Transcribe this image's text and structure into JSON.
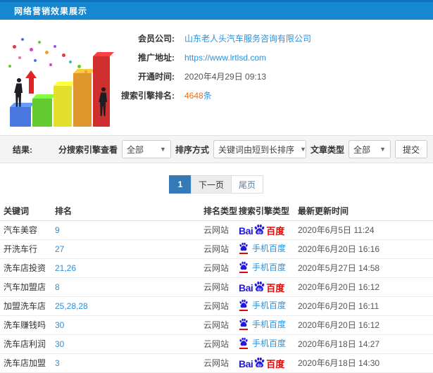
{
  "header": {
    "title": "网络营销效果展示"
  },
  "info": {
    "rows": [
      {
        "label": "会员公司:",
        "value": "山东老人头汽车服务咨询有限公司"
      },
      {
        "label": "推广地址:",
        "value": "https://www.lrtlsd.com"
      },
      {
        "label": "开通时间:",
        "value": "2020年4月29日 09:13"
      },
      {
        "label": "搜索引擎排名:",
        "value": "4648",
        "suffix": "条"
      }
    ]
  },
  "filter": {
    "result_label": "结果:",
    "engine_filter_label": "分搜索引擎查看",
    "engine_filter_value": "全部",
    "sort_label": "排序方式",
    "sort_value": "关键词由短到长排序",
    "article_type_label": "文章类型",
    "article_type_value": "全部",
    "submit_label": "提交"
  },
  "pagination": {
    "items": [
      {
        "label": "1",
        "active": true
      },
      {
        "label": "下一页",
        "active": false
      },
      {
        "label": "尾页",
        "active": false
      }
    ]
  },
  "logos": {
    "baidu": {
      "bai": "Bai",
      "du": "du",
      "cn": "百度"
    },
    "mobile": {
      "label": "手机百度"
    }
  },
  "table": {
    "headers": [
      "关键词",
      "排名",
      "排名类型",
      "搜索引擎类型",
      "最新更新时间"
    ],
    "rows": [
      {
        "keyword": "汽车美容",
        "rank": "9",
        "rank_type": "云网站",
        "engine": "baidu",
        "updated": "2020年6月5日 11:24"
      },
      {
        "keyword": "开洗车行",
        "rank": "27",
        "rank_type": "云网站",
        "engine": "mobile",
        "updated": "2020年6月20日 16:16"
      },
      {
        "keyword": "洗车店投资",
        "rank": "21,26",
        "rank_type": "云网站",
        "engine": "mobile",
        "updated": "2020年5月27日 14:58"
      },
      {
        "keyword": "汽车加盟店",
        "rank": "8",
        "rank_type": "云网站",
        "engine": "baidu",
        "updated": "2020年6月20日 16:12"
      },
      {
        "keyword": "加盟洗车店",
        "rank": "25,28,28",
        "rank_type": "云网站",
        "engine": "mobile",
        "updated": "2020年6月20日 16:11"
      },
      {
        "keyword": "洗车赚钱吗",
        "rank": "30",
        "rank_type": "云网站",
        "engine": "mobile",
        "updated": "2020年6月20日 16:12"
      },
      {
        "keyword": "洗车店利润",
        "rank": "30",
        "rank_type": "云网站",
        "engine": "mobile",
        "updated": "2020年6月18日 14:27"
      },
      {
        "keyword": "洗车店加盟",
        "rank": "3",
        "rank_type": "云网站",
        "engine": "baidu",
        "updated": "2020年6月18日 14:30"
      }
    ]
  },
  "colors": {
    "header_blue": "#1687d1",
    "link_blue": "#2a91dd",
    "highlight_orange": "#ff6600",
    "baidu_blue": "#2319dc",
    "baidu_red": "#e10601",
    "pagination_active": "#337ab7"
  }
}
